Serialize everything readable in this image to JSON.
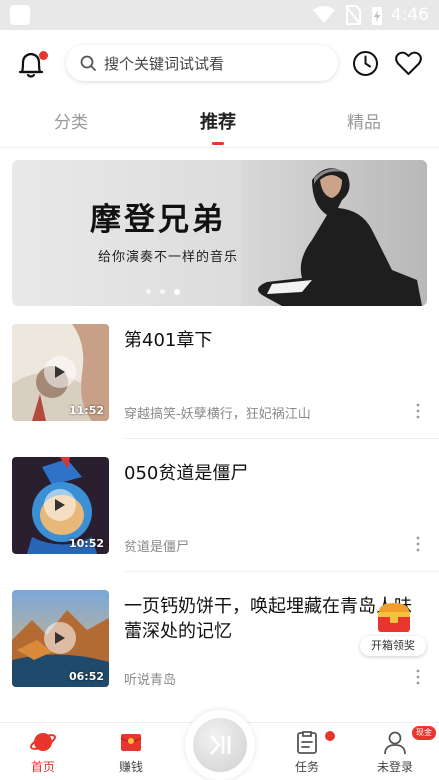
{
  "status_bar": {
    "time": "4:46"
  },
  "header": {
    "search_placeholder": "搜个关键词试试看"
  },
  "tabs": [
    {
      "label": "分类"
    },
    {
      "label": "推荐",
      "active": true
    },
    {
      "label": "精品"
    }
  ],
  "banner": {
    "title": "摩登兄弟",
    "subtitle": "给你演奏不一样的音乐",
    "dot_count": 3,
    "active_dot": 2
  },
  "items": [
    {
      "title": "第401章下",
      "subtitle": "穿越搞笑-妖孽横行，狂妃祸江山",
      "duration": "11:52"
    },
    {
      "title": "050贫道是僵尸",
      "subtitle": "贫道是僵尸",
      "duration": "10:52"
    },
    {
      "title": "一页钙奶饼干，唤起埋藏在青岛人味蕾深处的记忆",
      "subtitle": "听说青岛",
      "duration": "06:52"
    }
  ],
  "float_reward": {
    "label": "开箱领奖"
  },
  "bottom_nav": {
    "home": "首页",
    "earn": "赚钱",
    "tasks": "任务",
    "login": "未登录",
    "bonus_badge": "现金"
  },
  "colors": {
    "accent": "#e8352d"
  }
}
